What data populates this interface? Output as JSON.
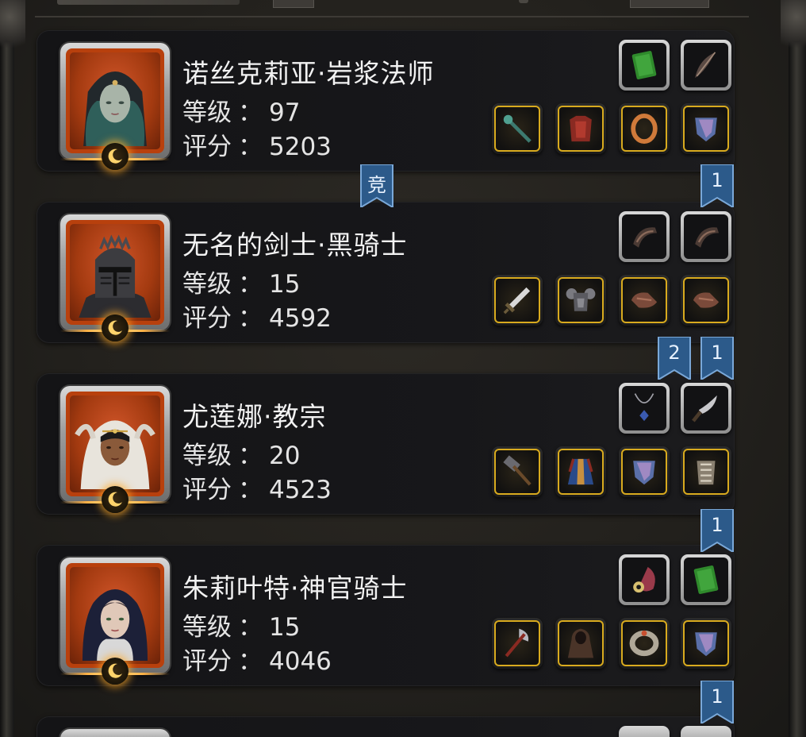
{
  "labels": {
    "level": "等级",
    "score": "评分",
    "separator": "："
  },
  "heroes": [
    {
      "name": "诺丝克莉亚·岩浆法师",
      "level": "97",
      "score": "5203",
      "portrait_icon": "hooded-mage-portrait-icon",
      "top_slots": [
        "green-tome-icon",
        "dark-feather-icon"
      ],
      "bottom_slots": [
        "serpent-staff-icon",
        "red-armor-icon",
        "bronze-ring-icon",
        "crystal-shield-icon"
      ]
    },
    {
      "name": "无名的剑士·黑骑士",
      "level": "15",
      "score": "4592",
      "portrait_icon": "black-knight-helm-portrait-icon",
      "top_slots": [
        "leather-bracer-icon",
        "leather-bracer-icon"
      ],
      "bottom_slots": [
        "greatsword-icon",
        "steel-breastplate-icon",
        "bronze-gauntlet-icon",
        "bronze-gauntlet-icon"
      ]
    },
    {
      "name": "尤莲娜·教宗",
      "level": "20",
      "score": "4523",
      "portrait_icon": "pope-priestess-portrait-icon",
      "top_slots": [
        "sapphire-necklace-icon",
        "curved-dagger-icon"
      ],
      "bottom_slots": [
        "war-hammer-icon",
        "ornate-robe-icon",
        "crystal-shield-icon",
        "bone-armor-icon"
      ]
    },
    {
      "name": "朱莉叶特·神官骑士",
      "level": "15",
      "score": "4046",
      "portrait_icon": "nun-knight-portrait-icon",
      "top_slots": [
        "eye-amulet-icon",
        "green-tome-icon"
      ],
      "bottom_slots": [
        "battle-axe-icon",
        "hooded-cloak-icon",
        "silver-bracelet-icon",
        "crystal-shield-icon"
      ]
    }
  ],
  "ribbons": [
    {
      "text": "竞",
      "after_card": 1
    },
    {
      "text": "1",
      "after_card": 1
    },
    {
      "text": "2",
      "after_card": 2
    },
    {
      "text": "1",
      "after_card": 2
    },
    {
      "text": "1",
      "after_card": 3
    },
    {
      "text": "1",
      "after_card": 4
    }
  ],
  "colors": {
    "card_bg": "#17171a",
    "portrait_orange": "#b8400d",
    "gold_slot_border": "#d8aa1e",
    "ribbon_blue": "#2c5a8a",
    "moon_glow": "#ffb347"
  }
}
